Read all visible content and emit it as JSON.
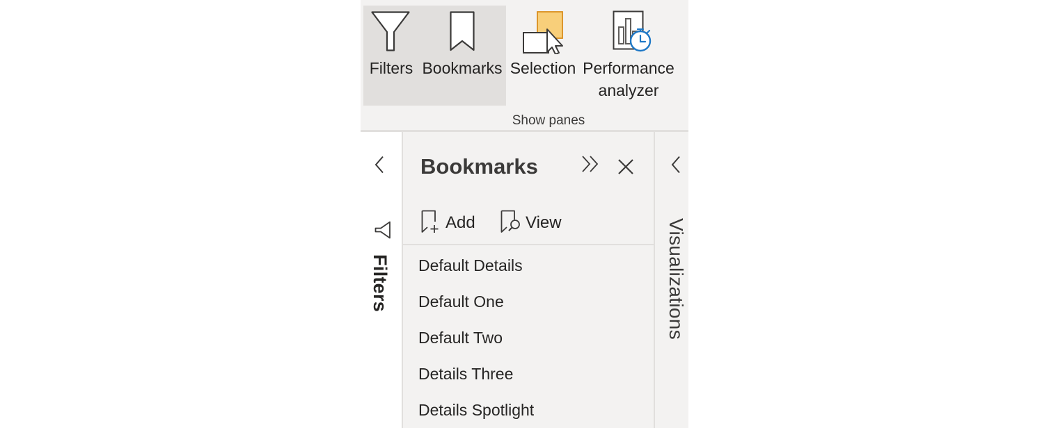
{
  "ribbon": {
    "buttons": [
      {
        "label": "Filters",
        "icon": "filter-icon",
        "active": true
      },
      {
        "label": "Bookmarks",
        "icon": "bookmark-icon",
        "active": true
      },
      {
        "label": "Selection",
        "icon": "selection-icon",
        "active": false
      },
      {
        "label_line1": "Performance",
        "label_line2": "analyzer",
        "icon": "performance-analyzer-icon",
        "active": false
      }
    ],
    "group_label": "Show panes"
  },
  "filters_pane": {
    "label": "Filters",
    "collapse_icon": "chevron-left-icon",
    "icon": "filter-funnel-icon"
  },
  "bookmarks_pane": {
    "title": "Bookmarks",
    "header_icons": [
      "double-chevron-right-icon",
      "close-icon"
    ],
    "toolbar": {
      "add_label": "Add",
      "view_label": "View"
    },
    "items": [
      "Default Details",
      "Default One",
      "Default Two",
      "Details Three",
      "Details Spotlight"
    ]
  },
  "visualizations_pane": {
    "label": "Visualizations",
    "collapse_icon": "chevron-left-icon"
  },
  "colors": {
    "selection_accent": "#f8cf7a",
    "selection_accent_border": "#d98e1d",
    "timer_blue": "#1f78c6",
    "active_button_bg": "#e1dfdd"
  }
}
